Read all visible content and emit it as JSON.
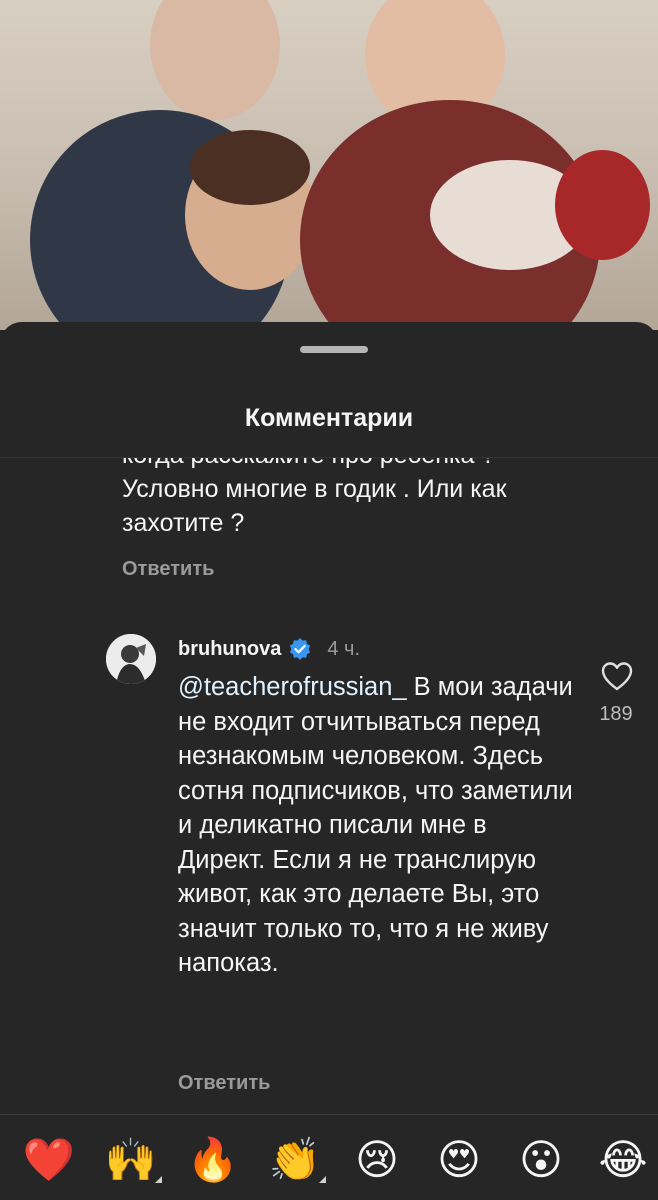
{
  "sheet": {
    "title": "Комментарии"
  },
  "previous_comment": {
    "text": "когда расскажите про ребенка ? Условно многие в годик . Или как захотите ?",
    "reply_label": "Ответить"
  },
  "comment": {
    "username": "bruhunova",
    "verified": true,
    "time": "4 ч.",
    "mention": "@teacherofrussian_",
    "text": " В мои задачи не входит отчитываться перед незнакомым человеком. Здесь сотня подписчиков, что заметили и деликатно писали мне в Директ. Если я не транслирую живот, как это делаете Вы, это значит только то, что я не живу напоказ.",
    "like_count": "189",
    "reply_label": "Ответить"
  },
  "emoji_bar": [
    {
      "icon": "heart-emoji",
      "char": "❤️"
    },
    {
      "icon": "raising-hands-emoji",
      "char": "🙌"
    },
    {
      "icon": "fire-emoji",
      "char": "🔥"
    },
    {
      "icon": "clapping-hands-emoji",
      "char": "👏"
    },
    {
      "icon": "crying-face-emoji",
      "char": "😢"
    },
    {
      "icon": "heart-eyes-emoji",
      "char": "😍"
    },
    {
      "icon": "surprised-face-emoji",
      "char": "😮"
    },
    {
      "icon": "tears-of-joy-emoji",
      "char": "😂"
    }
  ],
  "colors": {
    "sheet_background": "#262626",
    "verified_badge": "#3897f0",
    "secondary_text": "#9a9a9a"
  }
}
